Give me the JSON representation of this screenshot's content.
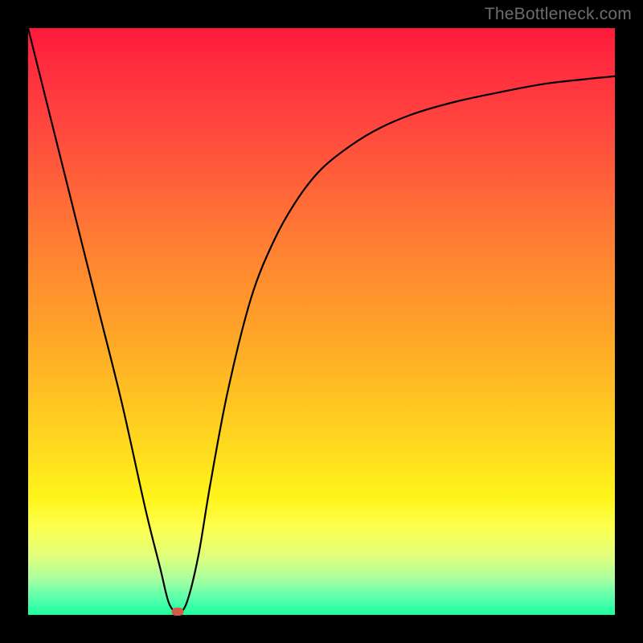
{
  "watermark": "TheBottleneck.com",
  "chart_data": {
    "type": "line",
    "title": "",
    "xlabel": "",
    "ylabel": "",
    "xlim": [
      0,
      100
    ],
    "ylim": [
      0,
      100
    ],
    "grid": false,
    "legend": false,
    "background_gradient": [
      "#ff1a3c",
      "#ffd020",
      "#19ff9f"
    ],
    "series": [
      {
        "name": "bottleneck-curve",
        "color": "#000000",
        "x": [
          0,
          4,
          8,
          12,
          16,
          20,
          22.5,
          24,
          25.5,
          27,
          29,
          31,
          34,
          38,
          42,
          46,
          50,
          55,
          60,
          66,
          73,
          80,
          88,
          95,
          100
        ],
        "y": [
          100,
          84,
          68,
          52,
          36,
          18,
          8,
          2,
          0.5,
          2,
          10,
          22,
          38,
          54,
          64,
          71,
          76,
          80,
          83,
          85.5,
          87.5,
          89,
          90.5,
          91.3,
          91.8
        ]
      }
    ],
    "marker": {
      "name": "optimal-point",
      "x": 25.5,
      "y": 0.5,
      "color": "#d45a4a"
    }
  }
}
